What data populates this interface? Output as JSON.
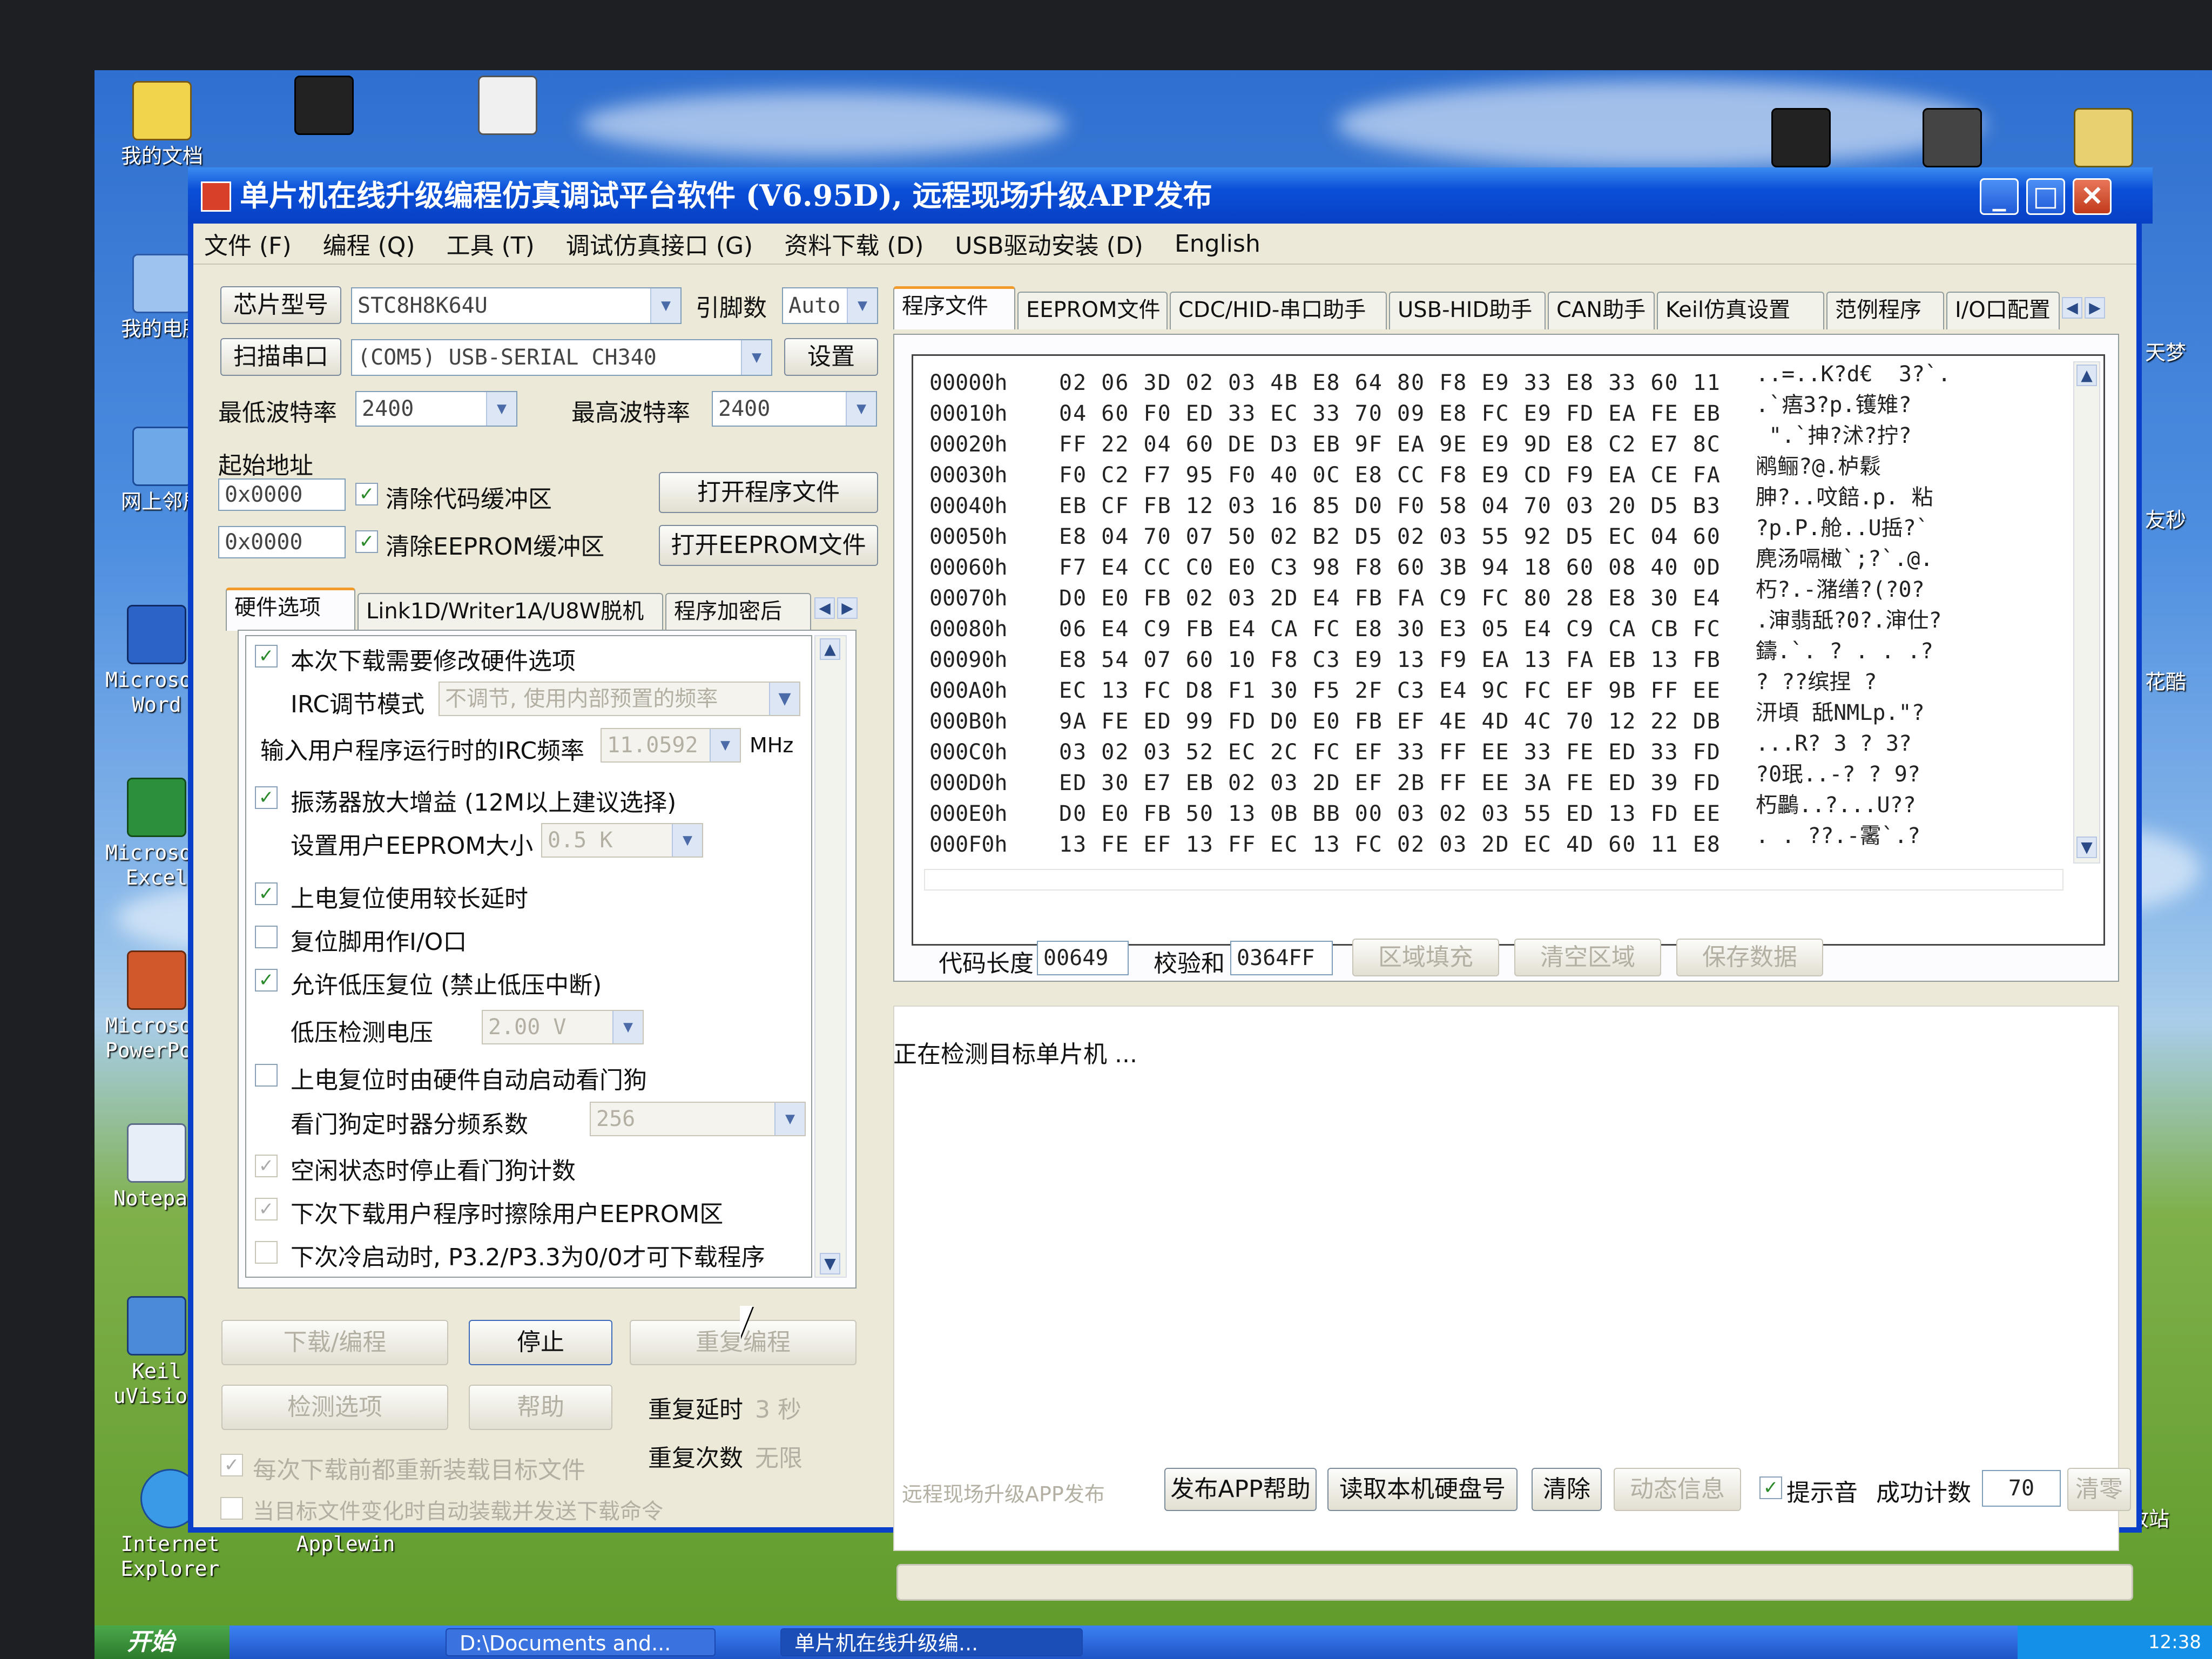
{
  "desktop": {
    "icons": [
      {
        "label": "我的文档"
      },
      {
        "label": "我的电脑"
      },
      {
        "label": "网上邻居"
      },
      {
        "label": "Microsoft Word"
      },
      {
        "label": "Microsoft Excel"
      },
      {
        "label": "Microsoft PowerPoint"
      },
      {
        "label": "Notepad"
      },
      {
        "label": "Keil uVision"
      },
      {
        "label": "Internet Explorer"
      },
      {
        "label": "Applewin"
      }
    ],
    "right_labels": [
      "天梦",
      "友秒",
      "花酷",
      "回收站"
    ]
  },
  "window": {
    "title": "单片机在线升级编程仿真调试平台软件 (V6.95D), 远程现场升级APP发布",
    "minimize": "_",
    "maximize": "□",
    "close": "✕"
  },
  "menu": [
    "文件 (F)",
    "编程 (Q)",
    "工具 (T)",
    "调试仿真接口 (G)",
    "资料下载 (D)",
    "USB驱动安装 (D)",
    "English"
  ],
  "left": {
    "chip_label": "芯片型号",
    "chip_value": "STC8H8K64U",
    "pin_label": "引脚数",
    "pin_value": "Auto",
    "scan_label": "扫描串口",
    "port_value": "(COM5) USB-SERIAL CH340",
    "settings_label": "设置",
    "min_baud_label": "最低波特率",
    "min_baud_value": "2400",
    "max_baud_label": "最高波特率",
    "max_baud_value": "2400",
    "start_addr_label": "起始地址",
    "code_addr": "0x0000",
    "clear_code_label": "清除代码缓冲区",
    "open_program_label": "打开程序文件",
    "eeprom_addr": "0x0000",
    "clear_eeprom_label": "清除EEPROM缓冲区",
    "open_eeprom_label": "打开EEPROM文件",
    "tabs": [
      "硬件选项",
      "Link1D/Writer1A/U8W脱机",
      "程序加密后"
    ],
    "options": [
      {
        "label": "本次下载需要修改硬件选项",
        "checked": true
      },
      {
        "label": "IRC调节模式",
        "combo": "不调节, 使用内部预置的频率"
      },
      {
        "label": "输入用户程序运行时的IRC频率",
        "combo": "11.0592",
        "unit": "MHz"
      },
      {
        "label": "振荡器放大增益 (12M以上建议选择)",
        "checked": true
      },
      {
        "label": "设置用户EEPROM大小",
        "combo": "0.5 K"
      },
      {
        "label": "上电复位使用较长延时",
        "checked": true
      },
      {
        "label": "复位脚用作I/O口",
        "checked": false
      },
      {
        "label": "允许低压复位 (禁止低压中断)",
        "checked": true
      },
      {
        "label": "低压检测电压",
        "combo": "2.00 V"
      },
      {
        "label": "上电复位时由硬件自动启动看门狗",
        "checked": false
      },
      {
        "label": "看门狗定时器分频系数",
        "combo": "256"
      },
      {
        "label": "空闲状态时停止看门狗计数",
        "checked": true
      },
      {
        "label": "下次下载用户程序时擦除用户EEPROM区",
        "checked": true
      },
      {
        "label": "下次冷启动时, P3.2/P3.3为0/0才可下载程序",
        "checked": false
      }
    ],
    "download_label": "下载/编程",
    "stop_label": "停止",
    "redownload_label": "重复编程",
    "check_options_label": "检测选项",
    "help_label": "帮助",
    "repeat_delay_label": "重复延时",
    "repeat_delay_value": "3 秒",
    "repeat_count_label": "重复次数",
    "repeat_count_value": "无限",
    "reload_before_label": "每次下载前都重新装载目标文件",
    "auto_send_label": "当目标文件变化时自动装载并发送下载命令"
  },
  "right": {
    "tabs": [
      "程序文件",
      "EEPROM文件",
      "CDC/HID-串口助手",
      "USB-HID助手",
      "CAN助手",
      "Keil仿真设置",
      "范例程序",
      "I/O口配置"
    ],
    "hex_rows": [
      {
        "addr": "00000h",
        "bytes": "02 06 3D 02 03 4B E8 64 80 F8 E9 33 E8 33 60 11",
        "ascii": "..=..K?d€  3?`."
      },
      {
        "addr": "00010h",
        "bytes": "04 60 F0 ED 33 EC 33 70 09 E8 FC E9 FD EA FE EB",
        "ascii": ".`痦3?p.镬雉?"
      },
      {
        "addr": "00020h",
        "bytes": "FF 22 04 60 DE D3 EB 9F EA 9E E9 9D E8 C2 E7 8C",
        "ascii": " \".`抻?沭?拧?"
      },
      {
        "addr": "00030h",
        "bytes": "F0 C2 F7 95 F0 40 0C E8 CC F8 E9 CD F9 EA CE FA",
        "ascii": "鹇鲡?@.栌鬏"
      },
      {
        "addr": "00040h",
        "bytes": "EB CF FB 12 03 16 85 D0 F0 58 04 70 03 20 D5 B3",
        "ascii": "胂?..呅餢.p. 粘"
      },
      {
        "addr": "00050h",
        "bytes": "E8 04 70 07 50 02 B2 D5 02 03 55 92 D5 EC 04 60",
        "ascii": "?p.P.舱..U捳?`"
      },
      {
        "addr": "00060h",
        "bytes": "F7 E4 CC C0 E0 C3 98 F8 60 3B 94 18 60 08 40 0D",
        "ascii": "麂汤嗝橄`;?`.@."
      },
      {
        "addr": "00070h",
        "bytes": "D0 E0 FB 02 03 2D E4 FB FA C9 FC 80 28 E8 30 E4",
        "ascii": "朽?.-潴缮?(?0?"
      },
      {
        "addr": "00080h",
        "bytes": "06 E4 C9 FB E4 CA FC E8 30 E3 05 E4 C9 CA CB FC",
        "ascii": ".渖翡舐?0?.渖仕?"
      },
      {
        "addr": "00090h",
        "bytes": "E8 54 07 60 10 F8 C3 E9 13 F9 EA 13 FA EB 13 FB",
        "ascii": "鑄.`. ? . . .?"
      },
      {
        "addr": "000A0h",
        "bytes": "EC 13 FC D8 F1 30 F5 2F C3 E4 9C FC EF 9B FF EE",
        "ascii": "? ??缤捏 ?"
      },
      {
        "addr": "000B0h",
        "bytes": "9A FE ED 99 FD D0 E0 FB EF 4E 4D 4C 70 12 22 DB",
        "ascii": "汧頃 舐NMLp.\"?"
      },
      {
        "addr": "000C0h",
        "bytes": "03 02 03 52 EC 2C FC EF 33 FF EE 33 FE ED 33 FD",
        "ascii": "...R? 3 ? 3?"
      },
      {
        "addr": "000D0h",
        "bytes": "ED 30 E7 EB 02 03 2D EF 2B FF EE 3A FE ED 39 FD",
        "ascii": "?0珉..-? ? 9?"
      },
      {
        "addr": "000E0h",
        "bytes": "D0 E0 FB 50 13 0B BB 00 03 02 03 55 ED 13 FD EE",
        "ascii": "朽鸓..?...U??"
      },
      {
        "addr": "000F0h",
        "bytes": "13 FE EF 13 FF EC 13 FC 02 03 2D EC 4D 60 11 E8",
        "ascii": ". . ??.-霱`.?"
      }
    ],
    "code_length_label": "代码长度",
    "code_length_value": "00649",
    "checksum_label": "校验和",
    "checksum_value": "0364FF",
    "fill_area_label": "区域填充",
    "clear_area_label": "清空区域",
    "save_data_label": "保存数据",
    "status_text": "正在检测目标单片机 ...",
    "remote_label": "远程现场升级APP发布",
    "publish_help_label": "发布APP帮助",
    "read_disk_label": "读取本机硬盘号",
    "clear_label": "清除",
    "dynamic_info_label": "动态信息",
    "beep_label": "提示音",
    "success_count_label": "成功计数",
    "success_count_value": "70",
    "reset_label": "清零"
  },
  "taskbar": {
    "start": "开始",
    "tasks": [
      "D:\\Documents and...",
      "单片机在线升级编..."
    ],
    "clock": "12:38"
  }
}
